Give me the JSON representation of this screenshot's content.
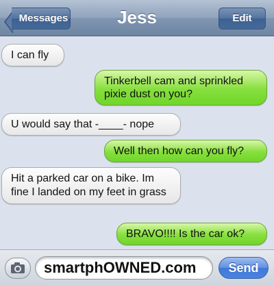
{
  "header": {
    "back_label": "Messages",
    "title": "Jess",
    "edit_label": "Edit"
  },
  "messages": [
    {
      "from": "them",
      "text": "I can fly"
    },
    {
      "from": "me",
      "text": "Tinkerbell cam and sprinkled pixie dust on you?"
    },
    {
      "from": "them",
      "text": "U would say that -____- nope"
    },
    {
      "from": "me",
      "text": "Well then how can you fly?"
    },
    {
      "from": "them",
      "text": "Hit a parked car on a bike. Im fine I landed on my feet in grass"
    },
    {
      "from": "me",
      "text": "BRAVO!!!! Is the car ok?"
    }
  ],
  "composer": {
    "input_value": "smartphOWNED.com",
    "send_label": "Send",
    "camera_icon": "camera-icon"
  },
  "colors": {
    "sent_bubble": "#7ed934",
    "received_bubble": "#e9e9e9",
    "nav_bar": "#8fa3bc",
    "send_button": "#4a83df"
  }
}
